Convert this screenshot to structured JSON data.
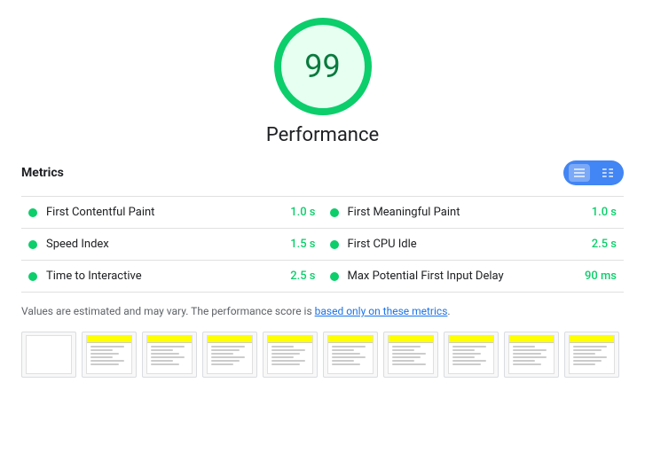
{
  "score": {
    "value": "99",
    "label": "Performance"
  },
  "metrics_section": {
    "title": "Metrics"
  },
  "metrics": [
    {
      "name": "First Contentful Paint",
      "value": "1.0 s",
      "col": "left"
    },
    {
      "name": "First Meaningful Paint",
      "value": "1.0 s",
      "col": "right"
    },
    {
      "name": "Speed Index",
      "value": "1.5 s",
      "col": "left"
    },
    {
      "name": "First CPU Idle",
      "value": "2.5 s",
      "col": "right"
    },
    {
      "name": "Time to Interactive",
      "value": "2.5 s",
      "col": "left"
    },
    {
      "name": "Max Potential First Input Delay",
      "value": "90 ms",
      "col": "right"
    }
  ],
  "footer": {
    "text_before": "Values are estimated and may vary. The performance score is ",
    "link_text": "based only on these metrics",
    "text_after": "."
  },
  "filmstrip": {
    "count": 10
  }
}
